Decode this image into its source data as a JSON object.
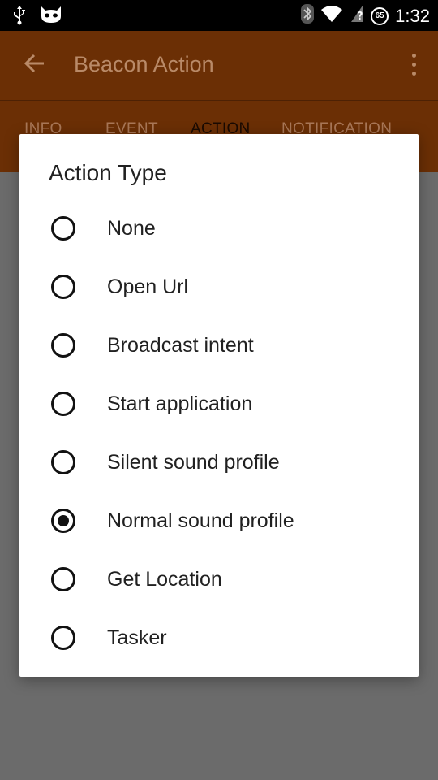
{
  "status_bar": {
    "time": "1:32",
    "battery_level": "65"
  },
  "app_bar": {
    "title": "Beacon Action"
  },
  "tabs": [
    {
      "label": "INFO"
    },
    {
      "label": "EVENT"
    },
    {
      "label": "ACTION"
    },
    {
      "label": "NOTIFICATION"
    }
  ],
  "dialog": {
    "title": "Action Type",
    "selected": "Normal sound profile",
    "options": [
      {
        "label": "None"
      },
      {
        "label": "Open Url"
      },
      {
        "label": "Broadcast intent"
      },
      {
        "label": "Start application"
      },
      {
        "label": "Silent sound profile"
      },
      {
        "label": "Normal sound profile"
      },
      {
        "label": "Get Location"
      },
      {
        "label": "Tasker"
      }
    ]
  },
  "colors": {
    "app_bar": "#6b2f05",
    "scrim": "#6b6b6b",
    "dialog_bg": "#ffffff"
  },
  "icons": {
    "usb": "usb-icon",
    "cyanogen": "cyanogen-icon",
    "bluetooth": "bluetooth-icon",
    "wifi": "wifi-icon",
    "signal": "signal-icon",
    "battery": "battery-icon",
    "back": "back-arrow-icon",
    "overflow": "more-vert-icon"
  }
}
